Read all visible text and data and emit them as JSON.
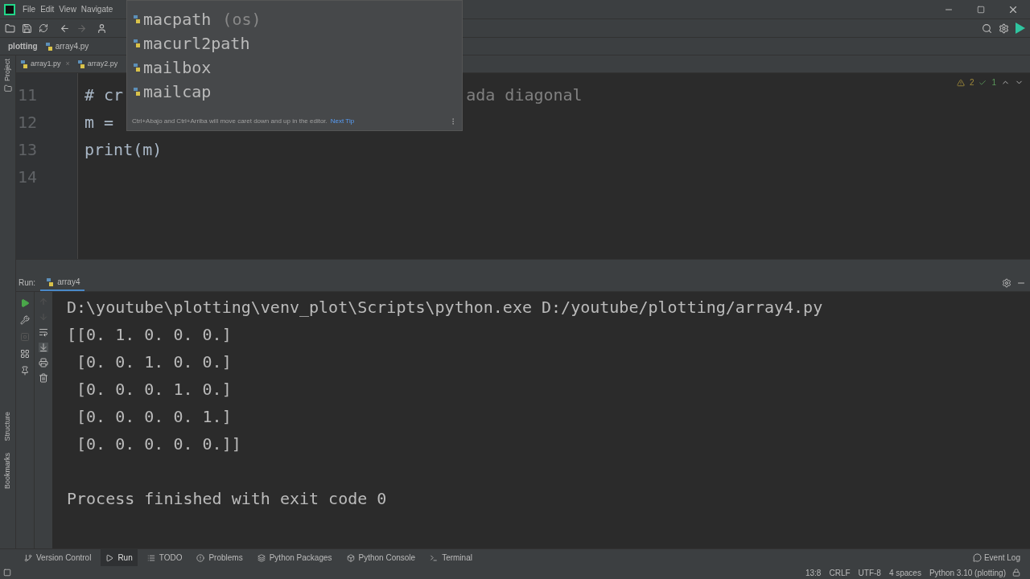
{
  "menu": [
    "File",
    "Edit",
    "View",
    "Navigate"
  ],
  "breadcrumb": {
    "project": "plotting",
    "file": "array4.py"
  },
  "tabs": [
    {
      "label": "array1.py",
      "selected": false,
      "close": "×"
    },
    {
      "label": "array2.py",
      "selected": false
    }
  ],
  "side_left": {
    "top": "Project",
    "bottom": [
      "Structure",
      "Bookmarks"
    ]
  },
  "inspections": {
    "warnings": "2",
    "weak": "1"
  },
  "editor": {
    "lines": [
      {
        "number": "11",
        "left": "# cr",
        "right": "ada diagonal"
      },
      {
        "number": "12",
        "left": "m = "
      },
      {
        "number": "13",
        "left": "print(m)"
      },
      {
        "number": "14"
      }
    ]
  },
  "completion": {
    "items": [
      {
        "name": "macpath",
        "hint": "(os)"
      },
      {
        "name": "macurl2path"
      },
      {
        "name": "mailbox"
      },
      {
        "name": "mailcap"
      }
    ],
    "tip": "Ctrl+Abajo and Ctrl+Arriba will move caret down and up in the editor.",
    "next": "Next Tip"
  },
  "run": {
    "label": "Run:",
    "tab": "array4",
    "output": [
      "D:\\youtube\\plotting\\venv_plot\\Scripts\\python.exe D:/youtube/plotting/array4.py",
      "[[0. 1. 0. 0. 0.]",
      " [0. 0. 1. 0. 0.]",
      " [0. 0. 0. 1. 0.]",
      " [0. 0. 0. 0. 1.]",
      " [0. 0. 0. 0. 0.]]"
    ],
    "result": "Process finished with exit code 0"
  },
  "tool_windows": [
    {
      "label": "Version Control",
      "selected": false
    },
    {
      "label": "Run",
      "selected": true
    },
    {
      "label": "TODO",
      "selected": false
    },
    {
      "label": "Problems",
      "selected": false
    },
    {
      "label": "Python Packages",
      "selected": false
    },
    {
      "label": "Python Console",
      "selected": false
    },
    {
      "label": "Terminal",
      "selected": false
    }
  ],
  "event_log": "Event Log",
  "status": [
    "13:8",
    "CRLF",
    "UTF-8",
    "4 spaces",
    "Python 3.10 (plotting)"
  ]
}
